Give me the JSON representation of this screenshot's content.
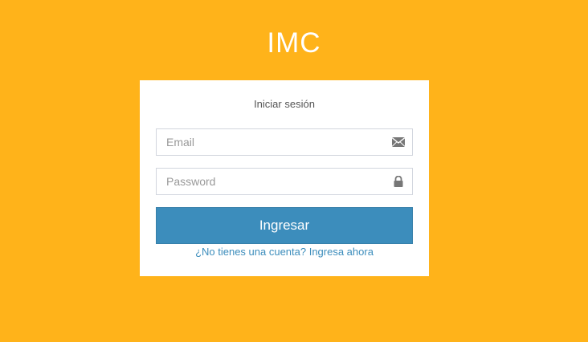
{
  "app": {
    "title": "IMC"
  },
  "login": {
    "heading": "Iniciar sesión",
    "email_placeholder": "Email",
    "email_icon": "envelope-icon",
    "password_placeholder": "Password",
    "password_icon": "lock-icon",
    "submit_label": "Ingresar",
    "register_link": "¿No tienes una cuenta? Ingresa ahora"
  },
  "colors": {
    "background": "#ffb31a",
    "panel": "#ffffff",
    "primary_button": "#3c8dbc",
    "link": "#3c8dbc"
  }
}
